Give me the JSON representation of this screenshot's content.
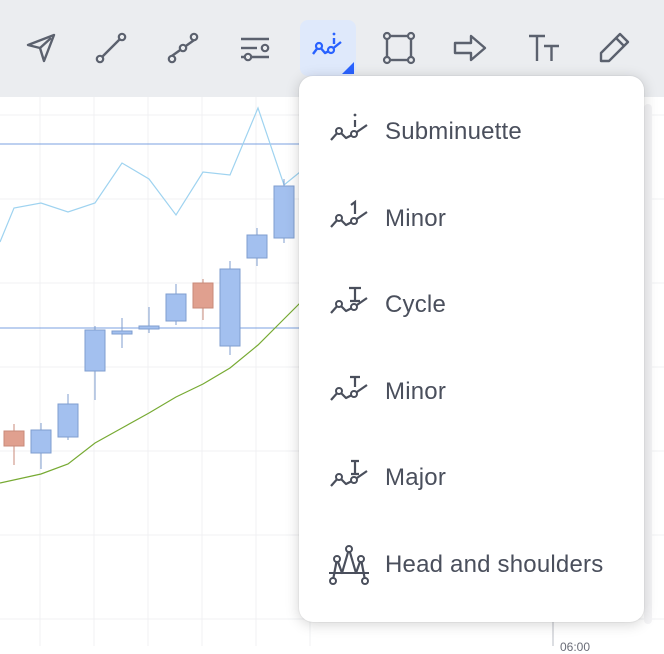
{
  "toolbar": {
    "tools": [
      {
        "icon": "arrow-cursor-icon",
        "active": false
      },
      {
        "icon": "trend-line-icon",
        "active": false
      },
      {
        "icon": "multi-point-line-icon",
        "active": false
      },
      {
        "icon": "fib-retracement-icon",
        "active": false
      },
      {
        "icon": "elliott-wave-icon",
        "active": true
      },
      {
        "icon": "rectangle-icon",
        "active": false
      },
      {
        "icon": "arrow-right-icon",
        "active": false
      },
      {
        "icon": "text-tool-icon",
        "active": false
      },
      {
        "icon": "brush-icon",
        "active": false
      }
    ],
    "accent_color": "#2962ff"
  },
  "menu": {
    "items": [
      {
        "label": "Subminuette",
        "icon": "elliott-subminuette-icon"
      },
      {
        "label": "Minor",
        "icon": "elliott-minor-1-icon"
      },
      {
        "label": "Cycle",
        "icon": "elliott-cycle-icon"
      },
      {
        "label": "Minor",
        "icon": "elliott-minor-t-icon"
      },
      {
        "label": "Major",
        "icon": "elliott-major-icon"
      },
      {
        "label": "Head and shoulders",
        "icon": "head-and-shoulders-icon"
      }
    ]
  },
  "chart": {
    "up_color": "#a3c0ef",
    "down_color": "#e0a08f",
    "ma_color": "#77aa33",
    "line_color": "#9fd3f0",
    "time_label": "06:00"
  }
}
